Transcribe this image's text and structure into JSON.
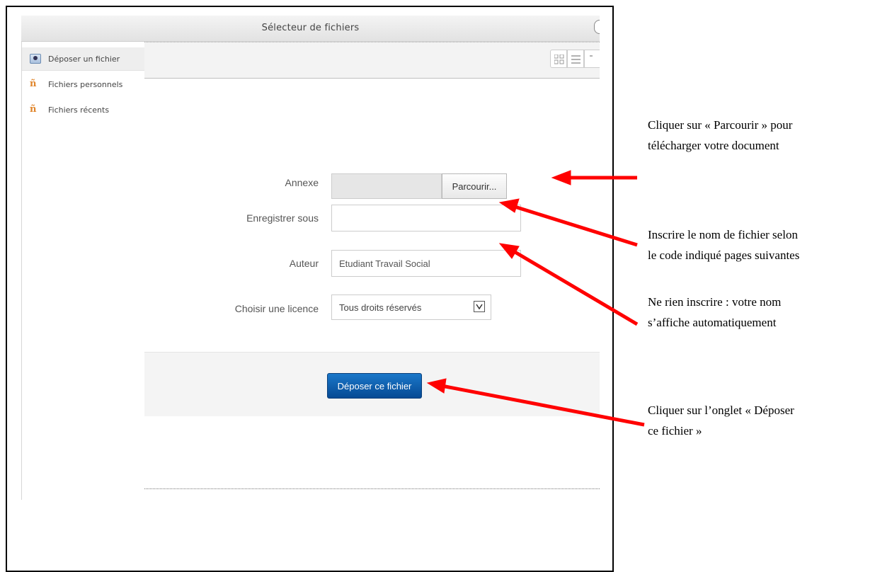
{
  "dialog": {
    "title": "Sélecteur de fichiers"
  },
  "sidebar": {
    "items": [
      {
        "label": "Déposer un fichier",
        "icon": "upload-icon",
        "active": true
      },
      {
        "label": "Fichiers personnels",
        "icon": "moodle-icon",
        "active": false
      },
      {
        "label": "Fichiers récents",
        "icon": "moodle-icon",
        "active": false
      }
    ]
  },
  "form": {
    "attachment_label": "Annexe",
    "browse_label": "Parcourir...",
    "save_as_label": "Enregistrer sous",
    "save_as_value": "",
    "author_label": "Auteur",
    "author_value": "Etudiant Travail Social",
    "license_label": "Choisir une licence",
    "license_value": "Tous droits réservés",
    "submit_label": "Déposer ce fichier"
  },
  "annotations": [
    {
      "lines": [
        "Cliquer sur « Parcourir » pour",
        "télécharger votre document"
      ]
    },
    {
      "lines": [
        "Inscrire le nom de fichier selon",
        "le code indiqué pages suivantes"
      ]
    },
    {
      "lines": [
        "Ne rien inscrire : votre nom",
        "s’affiche automatiquement"
      ]
    },
    {
      "lines": [
        "Cliquer sur l’onglet « Déposer",
        "ce fichier »"
      ]
    }
  ],
  "colors": {
    "arrow": "#ff0000",
    "submit": "#0b5cad"
  }
}
